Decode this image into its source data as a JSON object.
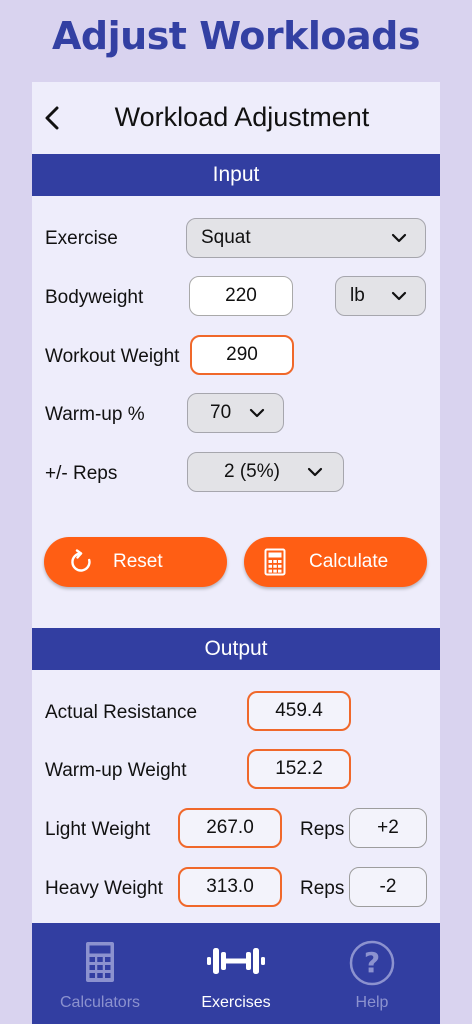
{
  "banner_title": "Adjust Workloads",
  "appbar": {
    "back_icon": "chevron-left-icon",
    "title": "Workload Adjustment"
  },
  "input": {
    "section_title": "Input",
    "exercise": {
      "label": "Exercise",
      "value": "Squat"
    },
    "bodyweight": {
      "label": "Bodyweight",
      "value": "220",
      "unit": "lb"
    },
    "workout_weight": {
      "label": "Workout Weight",
      "value": "290"
    },
    "warmup_percent": {
      "label": "Warm-up %",
      "value": "70"
    },
    "reps_adjust": {
      "label": "+/- Reps",
      "value": "2 (5%)"
    },
    "reset_button": {
      "label": "Reset",
      "icon": "refresh-icon"
    },
    "calculate_button": {
      "label": "Calculate",
      "icon": "calculator-icon"
    }
  },
  "output": {
    "section_title": "Output",
    "actual_resistance": {
      "label": "Actual Resistance",
      "value": "459.4"
    },
    "warmup_weight": {
      "label": "Warm-up Weight",
      "value": "152.2"
    },
    "light_weight": {
      "label": "Light Weight",
      "value": "267.0",
      "reps_label": "Reps",
      "reps_value": "+2"
    },
    "heavy_weight": {
      "label": "Heavy Weight",
      "value": "313.0",
      "reps_label": "Reps",
      "reps_value": "-2"
    }
  },
  "tabs": [
    {
      "label": "Calculators",
      "icon": "calculator-icon",
      "active": false
    },
    {
      "label": "Exercises",
      "icon": "dumbbell-icon",
      "active": true
    },
    {
      "label": "Help",
      "icon": "question-circle-icon",
      "active": false
    }
  ],
  "colors": {
    "background": "#d9d3ef",
    "brand_blue": "#323ea1",
    "accent_orange": "#ff5e14",
    "panel": "#eeedfb",
    "tab_active": "#ffffff",
    "tab_inactive": "#8c92cf"
  }
}
